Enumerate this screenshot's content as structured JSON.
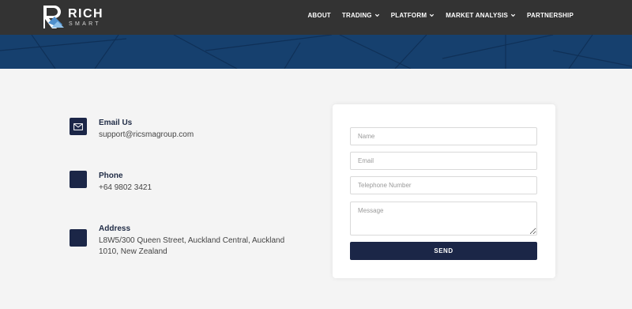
{
  "header": {
    "logo_title": "RICH",
    "logo_sub": "SMART",
    "nav": [
      {
        "label": "ABOUT",
        "icon": null
      },
      {
        "label": "TRADING",
        "icon": "chevron-down-icon"
      },
      {
        "label": "PLATFORM",
        "icon": "chevron-down-icon"
      },
      {
        "label": "MARKET ANALYSIS",
        "icon": "chevron-down-icon"
      },
      {
        "label": "PARTNERSHIP",
        "icon": null
      }
    ]
  },
  "contact": {
    "email": {
      "title": "Email Us",
      "value": "support@ricsmagroup.com",
      "icon": "envelope-icon"
    },
    "phone": {
      "title": "Phone",
      "value": "+64 9802 3421"
    },
    "address": {
      "title": "Address",
      "line1": "L8W5/300 Queen Street, Auckland Central, Auckland",
      "line2": "1010, New Zealand"
    }
  },
  "form": {
    "name_placeholder": "Name",
    "email_placeholder": "Email",
    "phone_placeholder": "Telephone Number",
    "message_placeholder": "Message",
    "send_label": "SEND"
  },
  "colors": {
    "header_bg": "#333333",
    "banner_bg": "#16406e",
    "accent_navy": "#1b2647",
    "page_bg": "#f4f4f4"
  }
}
